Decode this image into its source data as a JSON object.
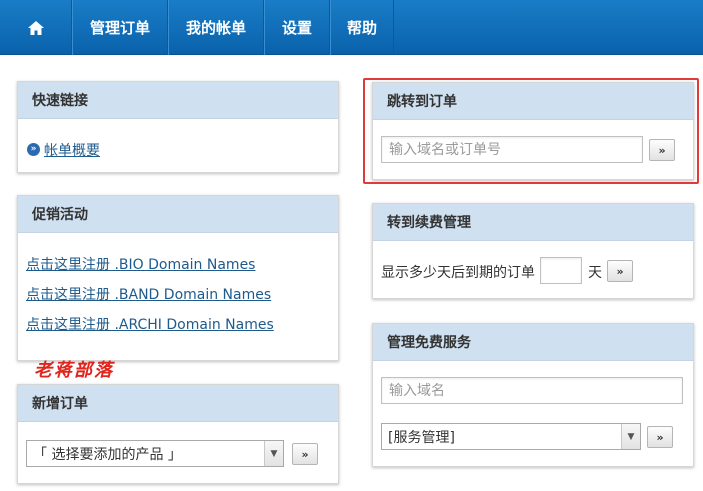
{
  "nav": {
    "home_icon": "home-icon",
    "items": [
      "管理订单",
      "我的帐单",
      "设置",
      "帮助"
    ]
  },
  "quick_links": {
    "title": "快速链接",
    "link": "帐单概要"
  },
  "promo": {
    "title": "促销活动",
    "links": [
      "点击这里注册 .BIO Domain Names",
      "点击这里注册 .BAND Domain Names",
      "点击这里注册 .ARCHI Domain Names"
    ]
  },
  "watermark": "老蒋部落",
  "new_order": {
    "title": "新增订单",
    "select_value": "「 选择要添加的产品 」",
    "go_label": "»"
  },
  "jump_order": {
    "title": "跳转到订单",
    "placeholder": "输入域名或订单号",
    "go_label": "»"
  },
  "renewal": {
    "title": "转到续费管理",
    "label_before": "显示多少天后到期的订单",
    "label_after": "天",
    "days_value": "",
    "go_label": "»"
  },
  "free_services": {
    "title": "管理免费服务",
    "placeholder": "输入域名",
    "select_value": "[服务管理]",
    "go_label": "»"
  },
  "colors": {
    "nav_bg": "#0a62ab",
    "panel_header_bg": "#cfe0f0",
    "link": "#1e5a8c",
    "highlight": "#e03a3a",
    "watermark": "#e0241b"
  }
}
